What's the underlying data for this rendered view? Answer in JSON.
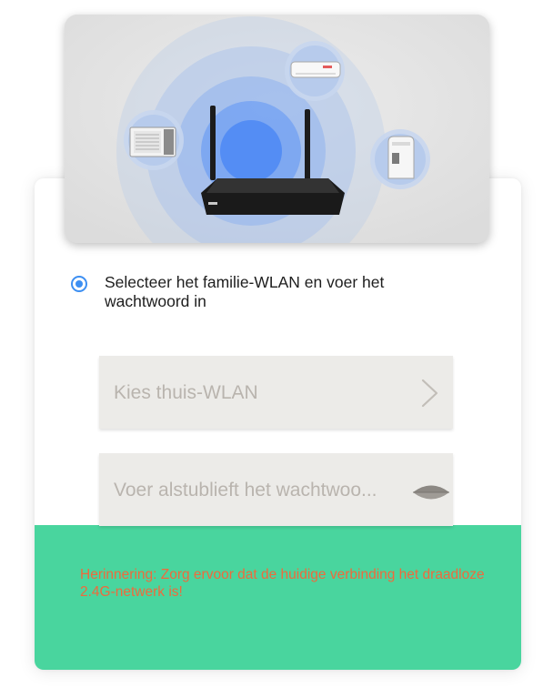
{
  "step": {
    "text": "Selecteer het familie-WLAN en voer het wachtwoord in",
    "selected": true
  },
  "wifi_field": {
    "label": "Kies thuis-WLAN",
    "icon": "chevron-right-icon"
  },
  "password_field": {
    "placeholder": "Voer alstublieft het wachtwoo...",
    "icon": "eye-icon"
  },
  "reminder": {
    "text": "Herinnering: Zorg ervoor dat de huidige verbinding het draadloze 2.4G-netwerk is!"
  },
  "illustration": {
    "icons": [
      "router-icon",
      "window-air-conditioner-icon",
      "split-air-conditioner-icon",
      "dehumidifier-icon"
    ]
  },
  "colors": {
    "accent": "#3d8ff2",
    "bottom_panel": "#49d59e",
    "reminder_text": "#ef6a3c",
    "field_background": "#ecebe8",
    "placeholder_text": "#b9b4ae"
  }
}
